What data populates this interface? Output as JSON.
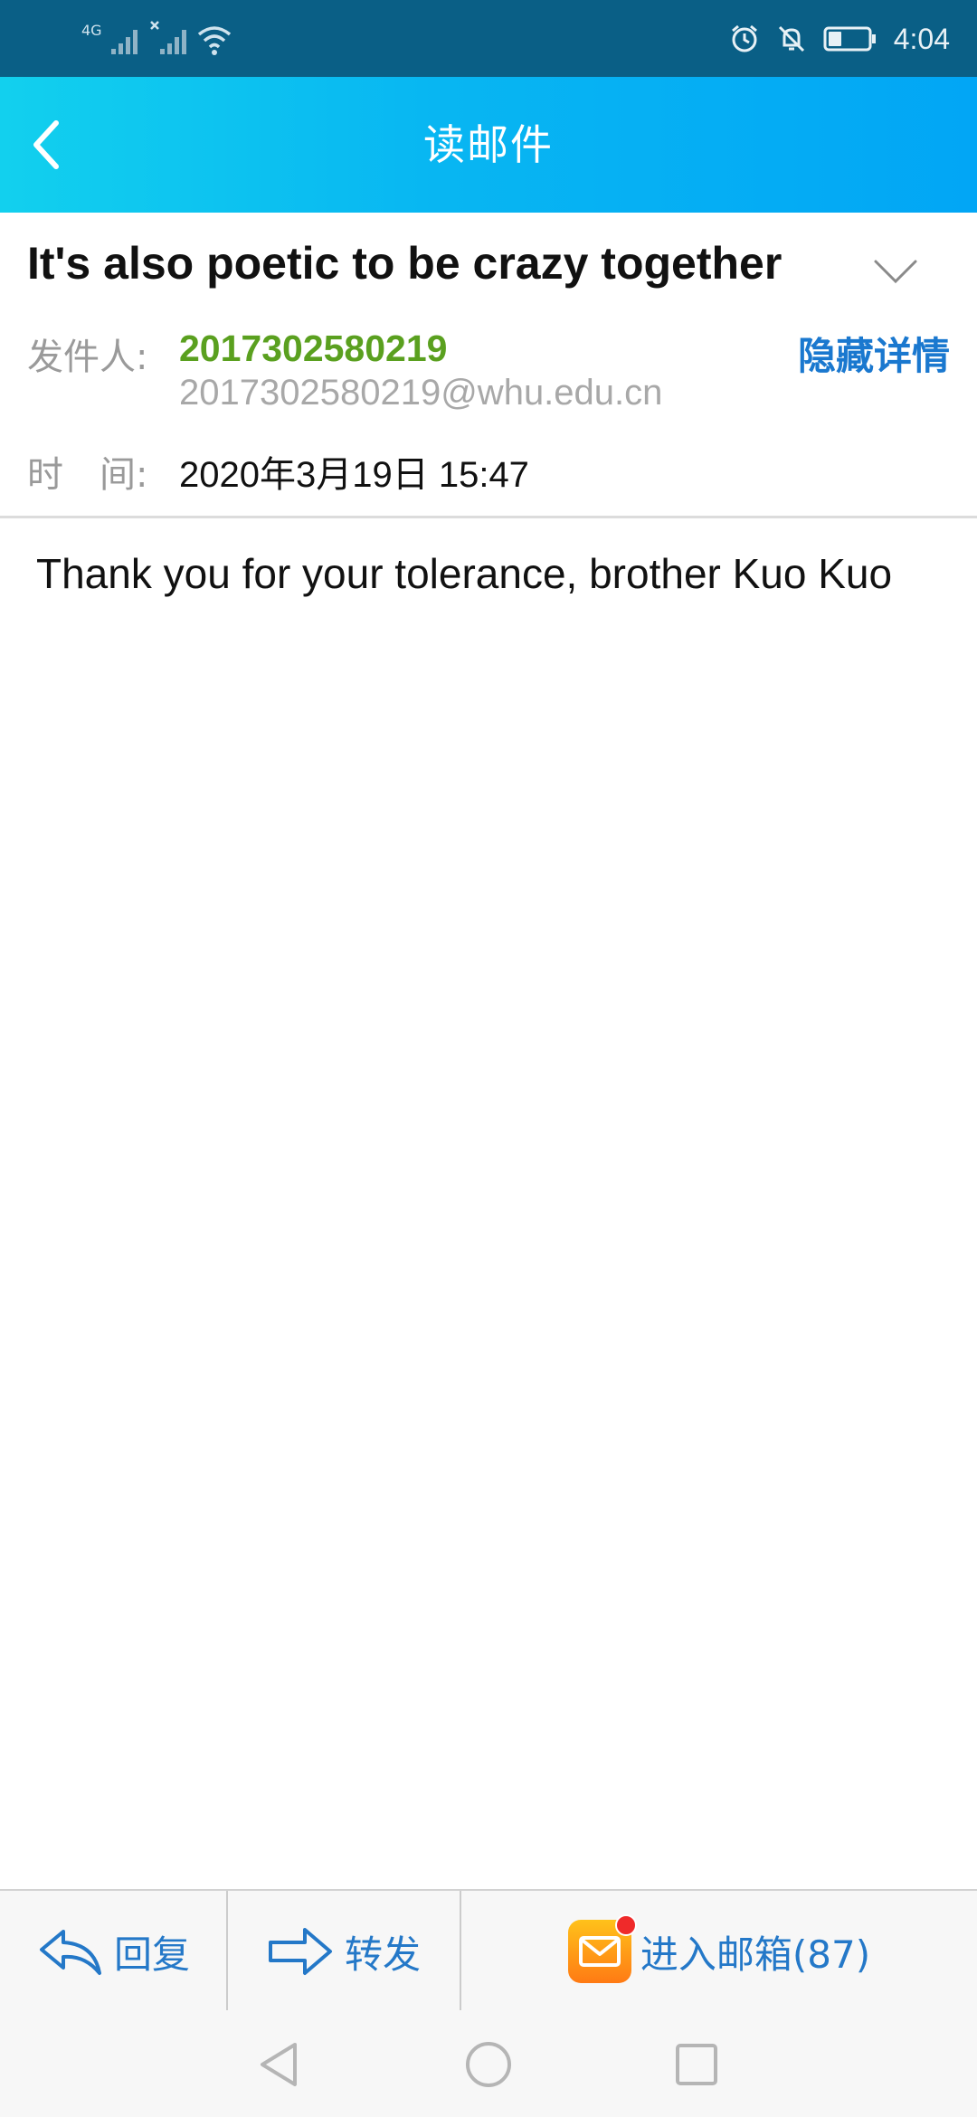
{
  "status_bar": {
    "network_label": "4G",
    "time": "4:04"
  },
  "header": {
    "title": "读邮件"
  },
  "mail": {
    "subject": "It's also poetic to be crazy together",
    "sender_label": "发件人:",
    "sender_name": "2017302580219",
    "sender_email": "2017302580219@whu.edu.cn",
    "hide_details_label": "隐藏详情",
    "time_label": "时　间:",
    "time_value": "2020年3月19日 15:47",
    "body": "Thank you for your tolerance, brother Kuo Kuo"
  },
  "toolbar": {
    "reply_label": "回复",
    "forward_label": "转发",
    "mailbox_label": "进入邮箱(87)"
  },
  "colors": {
    "header_gradient_start": "#12d0ee",
    "header_gradient_end": "#02a6f5",
    "status_bar": "#0a5f86",
    "sender_green": "#5aa01f",
    "link_blue": "#1a78cf",
    "toolbar_blue": "#2478c8"
  },
  "icons": {
    "back": "chevron-left-icon",
    "expand": "chevron-down-icon",
    "reply": "reply-arrow-icon",
    "forward": "forward-arrow-icon",
    "mailbox": "mail-envelope-icon"
  }
}
